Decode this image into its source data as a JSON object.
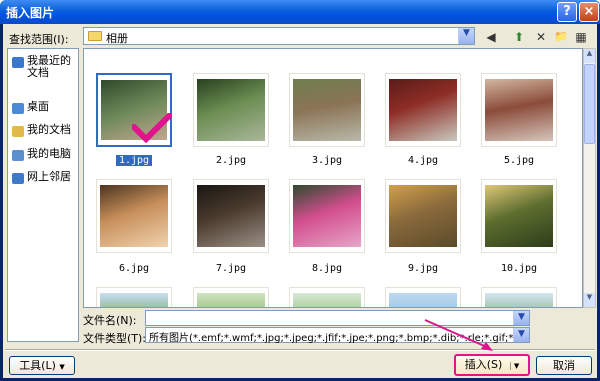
{
  "window": {
    "title": "插入图片",
    "help": "?",
    "close": "×"
  },
  "lookin": {
    "label": "查找范围(I):",
    "value": "相册"
  },
  "toolbar": {
    "back": "◀",
    "up": "⬆",
    "delete": "✕",
    "newfolder": "📁",
    "views": "▦"
  },
  "places": [
    {
      "label": "我最近的文档",
      "color": "#3a78c8"
    },
    {
      "label": "桌面",
      "color": "#4a8ad6"
    },
    {
      "label": "我的文档",
      "color": "#e2b84a"
    },
    {
      "label": "我的电脑",
      "color": "#5a8fd0"
    },
    {
      "label": "网上邻居",
      "color": "#3d7ac9"
    }
  ],
  "files": [
    {
      "name": "1.jpg",
      "selected": true,
      "bg": "linear-gradient(160deg,#2f4a2a,#6e8a5a 50%,#c3a68f)"
    },
    {
      "name": "2.jpg",
      "bg": "linear-gradient(160deg,#27411f,#6b8d51 45%,#a9b79a)"
    },
    {
      "name": "3.jpg",
      "bg": "linear-gradient(170deg,#6f7e4e,#8b7456 45%,#b8b9a9)"
    },
    {
      "name": "4.jpg",
      "bg": "linear-gradient(160deg,#5a1c1a,#8d2d24 40%,#c9c9bf)"
    },
    {
      "name": "5.jpg",
      "bg": "linear-gradient(170deg,#d3b7a1,#8b4c3a 45%,#d5c5ba)"
    },
    {
      "name": "6.jpg",
      "bg": "linear-gradient(160deg,#4d3520,#c78f5a 45%,#f0d3ae)"
    },
    {
      "name": "7.jpg",
      "bg": "linear-gradient(160deg,#1a1613,#4a3b2d 45%,#9c8f85)"
    },
    {
      "name": "8.jpg",
      "bg": "linear-gradient(160deg,#2d4a2d,#d24e8e 45%,#e7a6c8)"
    },
    {
      "name": "9.jpg",
      "bg": "linear-gradient(160deg,#d2a04c,#8a6a3c 45%,#5b4b2a)"
    },
    {
      "name": "10.jpg",
      "bg": "linear-gradient(160deg,#e0c67a,#5d6e2e 45%,#2d3c1b)"
    },
    {
      "name": "",
      "bg": "linear-gradient(#c9e0f0,#5b8f4a 55%,#3f6e31)"
    },
    {
      "name": "",
      "bg": "linear-gradient(#cfe5c0,#7aa35b 55%,#4c7a36)"
    },
    {
      "name": "",
      "bg": "linear-gradient(#d8ead6,#7fb064 55%,#4f7d3a)"
    },
    {
      "name": "",
      "bg": "linear-gradient(#bcd9f2,#92b8d8 50%,#5b8f47)"
    },
    {
      "name": "",
      "bg": "linear-gradient(#d3e6f5,#6e9c5a 55%,#3d6c30)"
    }
  ],
  "filename": {
    "label": "文件名(N):",
    "value": ""
  },
  "filetype": {
    "label": "文件类型(T):",
    "value": "所有图片(*.emf;*.wmf;*.jpg;*.jpeg;*.jfif;*.jpe;*.png;*.bmp;*.dib;*.rle;*.gif;*."
  },
  "buttons": {
    "tools": "工具(L)",
    "insert": "插入(S)",
    "cancel": "取消"
  },
  "accent": "#e0148c"
}
